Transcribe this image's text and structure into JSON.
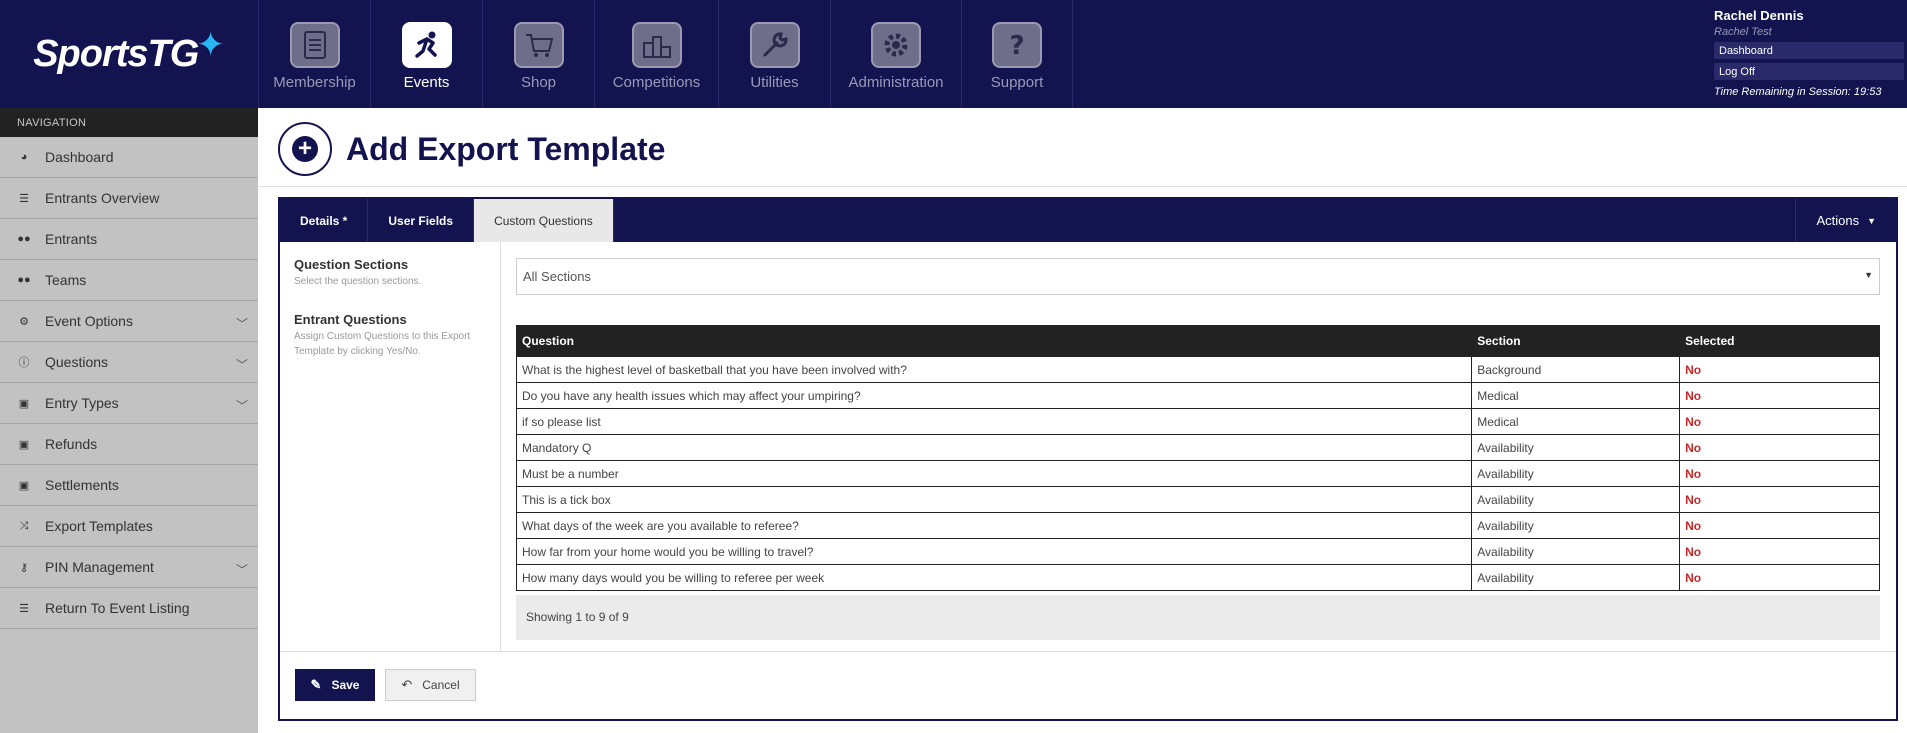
{
  "brand": {
    "logo_text": "SportsTG",
    "logo_mark": "star-swoosh"
  },
  "top_nav": [
    {
      "label": "Membership",
      "icon": "clipboard-icon",
      "active": false
    },
    {
      "label": "Events",
      "icon": "runner-icon",
      "active": true
    },
    {
      "label": "Shop",
      "icon": "cart-icon",
      "active": false
    },
    {
      "label": "Competitions",
      "icon": "podium-icon",
      "active": false
    },
    {
      "label": "Utilities",
      "icon": "wrench-icon",
      "active": false
    },
    {
      "label": "Administration",
      "icon": "gear-icon",
      "active": false
    },
    {
      "label": "Support",
      "icon": "question-icon",
      "active": false
    }
  ],
  "user": {
    "name": "Rachel Dennis",
    "org": "Rachel Test",
    "links": [
      "Dashboard",
      "Log Off"
    ],
    "session": "Time Remaining in Session: 19:53"
  },
  "sidebar": {
    "heading": "NAVIGATION",
    "items": [
      {
        "label": "Dashboard",
        "icon": "dashboard-icon",
        "expandable": false
      },
      {
        "label": "Entrants Overview",
        "icon": "list-icon",
        "expandable": false
      },
      {
        "label": "Entrants",
        "icon": "users-icon",
        "expandable": false
      },
      {
        "label": "Teams",
        "icon": "users-icon",
        "expandable": false
      },
      {
        "label": "Event Options",
        "icon": "cogs-icon",
        "expandable": true
      },
      {
        "label": "Questions",
        "icon": "info-icon",
        "expandable": true
      },
      {
        "label": "Entry Types",
        "icon": "money-icon",
        "expandable": true
      },
      {
        "label": "Refunds",
        "icon": "money-icon",
        "expandable": false
      },
      {
        "label": "Settlements",
        "icon": "money-icon",
        "expandable": false
      },
      {
        "label": "Export Templates",
        "icon": "shuffle-icon",
        "expandable": false
      },
      {
        "label": "PIN Management",
        "icon": "key-icon",
        "expandable": true
      },
      {
        "label": "Return To Event Listing",
        "icon": "list-icon",
        "expandable": false
      }
    ]
  },
  "page": {
    "title": "Add Export Template"
  },
  "tabs": [
    {
      "label": "Details *",
      "active": false
    },
    {
      "label": "User Fields",
      "active": false
    },
    {
      "label": "Custom Questions",
      "active": true
    }
  ],
  "actions_label": "Actions",
  "form": {
    "sections_label": "Question Sections",
    "sections_help": "Select the question sections.",
    "sections_value": "All Sections",
    "questions_label": "Entrant Questions",
    "questions_help": "Assign Custom Questions to this Export Template by clicking Yes/No."
  },
  "table": {
    "headers": [
      "Question",
      "Section",
      "Selected"
    ],
    "rows": [
      [
        "What is the highest level of basketball that you have been involved with?",
        "Background",
        "No"
      ],
      [
        "Do you have any health issues which may affect your umpiring?",
        "Medical",
        "No"
      ],
      [
        "if so please list",
        "Medical",
        "No"
      ],
      [
        "Mandatory Q",
        "Availability",
        "No"
      ],
      [
        "Must be a number",
        "Availability",
        "No"
      ],
      [
        "This is a tick box",
        "Availability",
        "No"
      ],
      [
        "What days of the week are you available to referee?",
        "Availability",
        "No"
      ],
      [
        "How far from your home would you be willing to travel?",
        "Availability",
        "No"
      ],
      [
        "How many days would you be willing to referee per week",
        "Availability",
        "No"
      ]
    ],
    "info": "Showing 1 to 9 of 9"
  },
  "buttons": {
    "save": "Save",
    "cancel": "Cancel"
  },
  "colors": {
    "navy": "#13134f",
    "sidebar": "#c2c2c2",
    "no_red": "#c62828",
    "accent_blue": "#29b6f6"
  }
}
